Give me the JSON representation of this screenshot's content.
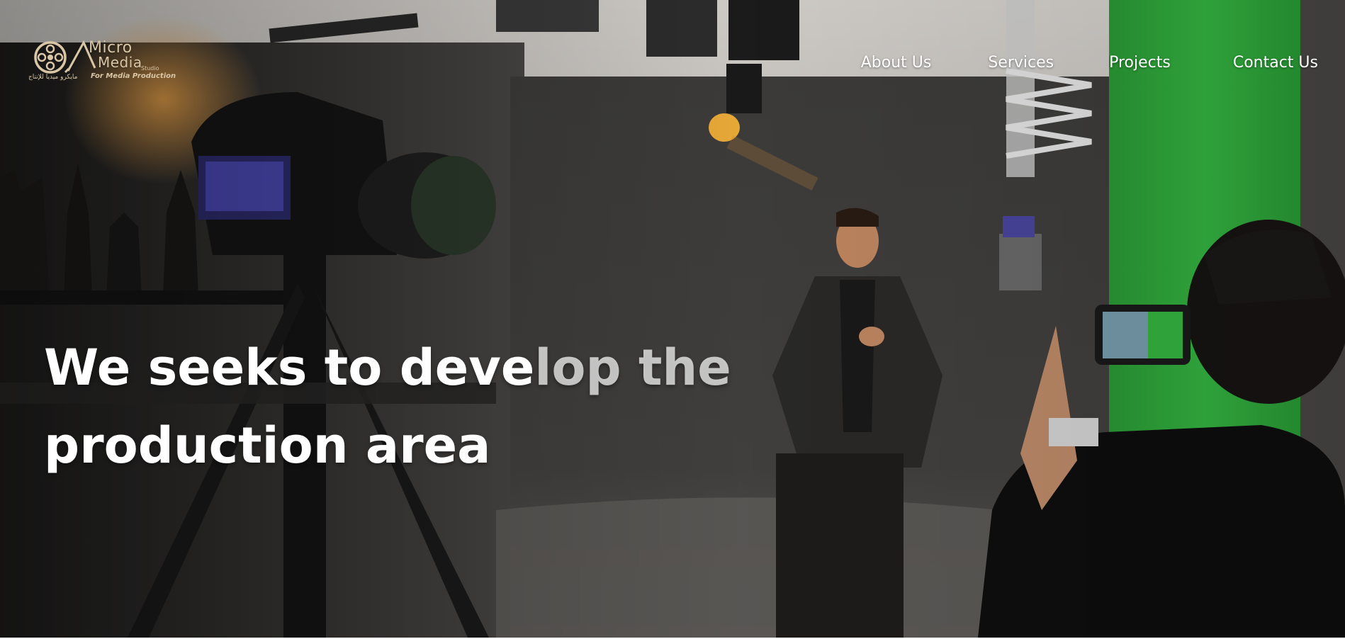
{
  "logo": {
    "word_top": "Micro",
    "word_bottom": "Media",
    "small_mark": "Studio",
    "tagline": "For Media Production",
    "arabic": "مايكرو ميديا للإنتاج"
  },
  "nav": {
    "items": [
      {
        "label": "About Us"
      },
      {
        "label": "Services"
      },
      {
        "label": "Projects"
      },
      {
        "label": "Contact Us"
      }
    ]
  },
  "hero": {
    "headline_line1_part1": "We seeks to deve",
    "headline_line1_part2": "lop the",
    "headline_line2": "production area"
  },
  "colors": {
    "logo_gold": "#d9c6a6",
    "nav_text": "#ffffff",
    "green_screen": "#2fae3c",
    "backdrop": "#3b3a39"
  }
}
